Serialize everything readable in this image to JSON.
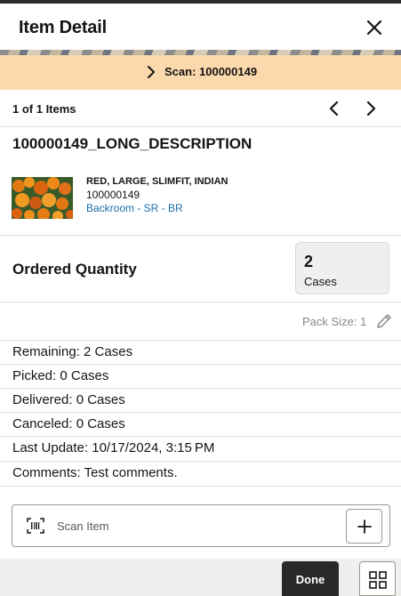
{
  "header": {
    "title": "Item Detail"
  },
  "scan_banner": {
    "text": "Scan: 100000149"
  },
  "pager": {
    "count": "1 of 1 Items"
  },
  "item": {
    "name": "100000149_LONG_DESCRIPTION",
    "attributes": "RED, LARGE, SLIMFIT, INDIAN",
    "id": "100000149",
    "location": "Backroom - SR - BR"
  },
  "ordered": {
    "label": "Ordered Quantity",
    "quantity": "2",
    "unit": "Cases"
  },
  "pack_size": "Pack Size: 1",
  "details": [
    "Remaining: 2 Cases",
    "Picked: 0 Cases",
    "Delivered: 0 Cases",
    "Canceled: 0 Cases",
    "Last Update: 10/17/2024, 3:15 PM",
    "Comments: Test comments."
  ],
  "scan_input": {
    "placeholder": "Scan Item"
  },
  "footer": {
    "done_label": "Done"
  },
  "colors": {
    "scan_banner_bg": "#fbd9ac",
    "link": "#1b6ea8",
    "done_bg": "#2b2927"
  },
  "icons": [
    "close-icon",
    "chevron-right-icon",
    "chevron-left-icon",
    "pencil-icon",
    "barcode-icon",
    "plus-icon",
    "grid-icon"
  ]
}
